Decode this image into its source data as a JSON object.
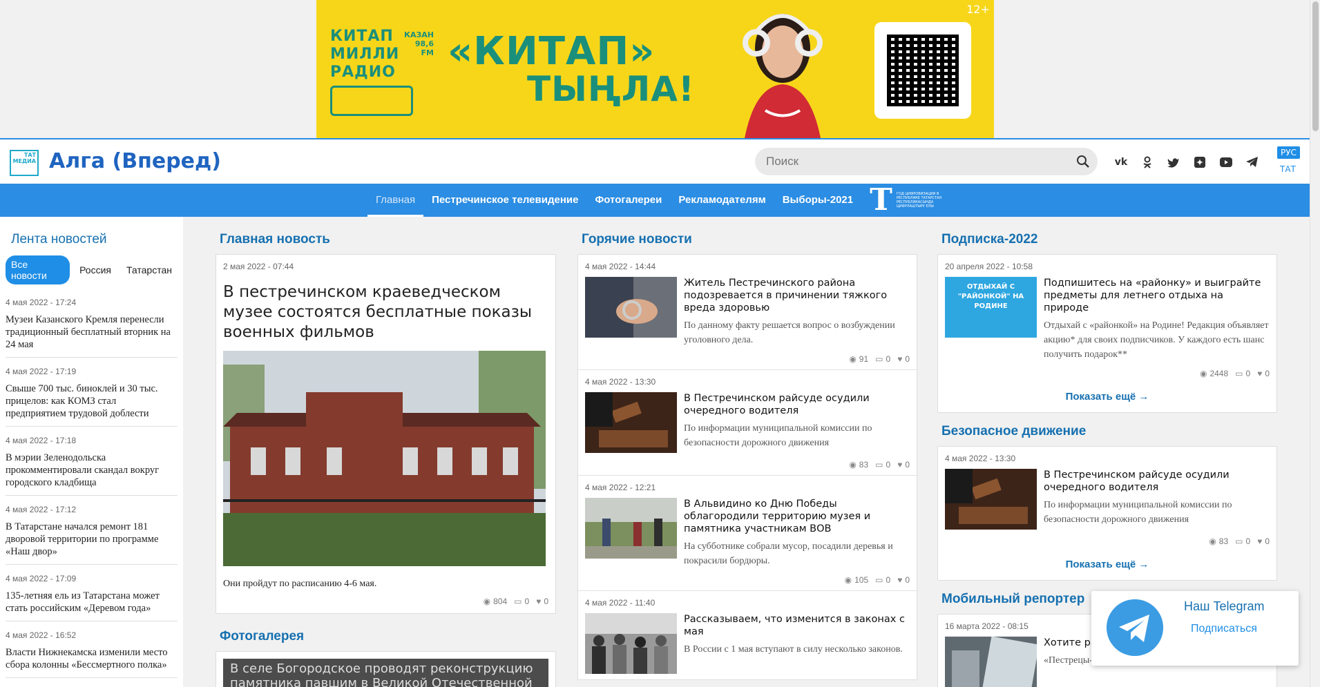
{
  "ad": {
    "logo_line1": "КИТАП",
    "logo_line2": "МИЛЛИ",
    "logo_line3": "РАДИО",
    "logo_city": "КАЗАН",
    "logo_freq": "98,6",
    "logo_fm": "FM",
    "title1": "«КИТАП»",
    "title2": "ТЫҢЛА!",
    "age": "12+",
    "accent": "#f7d61a",
    "text_color": "#1a8f7c"
  },
  "header": {
    "logo_text": "ТАТ МЕДИА",
    "title": "Алга (Вперед)",
    "search_placeholder": "Поиск",
    "socials": [
      "vk-icon",
      "odnoklassniki-icon",
      "twitter-icon",
      "yandex-zen-icon",
      "youtube-icon",
      "telegram-icon"
    ],
    "lang_active": "РУС",
    "lang_other": "ТАТ"
  },
  "nav": {
    "items": [
      "Главная",
      "Пестречинское телевидение",
      "Фотогалереи",
      "Рекламодателям",
      "Выборы-2021"
    ],
    "badge_letter": "Т",
    "badge_text": "ГОД ЦИФРОВИЗАЦИИ В РЕСПУБЛИКЕ ТАТАРСТАН РЕСПУБЛИКАСЫНДА ЦИФРЛАШТЫРУ ЕЛЫ",
    "color": "#2b8de3"
  },
  "feed": {
    "title": "Лента новостей",
    "tabs": [
      "Все новости",
      "Россия",
      "Татарстан"
    ],
    "items": [
      {
        "time": "4 мая 2022 - 17:24",
        "text": "Музеи Казанского Кремля перенесли традиционный бесплатный вторник на 24 мая"
      },
      {
        "time": "4 мая 2022 - 17:19",
        "text": "Свыше 700 тыс. биноклей и 30 тыс. прицелов: как КОМЗ стал предприятием трудовой доблести"
      },
      {
        "time": "4 мая 2022 - 17:18",
        "text": "В мэрии Зеленодольска прокомментировали скандал вокруг городского кладбища"
      },
      {
        "time": "4 мая 2022 - 17:12",
        "text": "В Татарстане начался ремонт 181 дворовой территории по программе «Наш двор»"
      },
      {
        "time": "4 мая 2022 - 17:09",
        "text": "135-летняя ель из Татарстана может стать российским «Деревом года»"
      },
      {
        "time": "4 мая 2022 - 16:52",
        "text": "Власти Нижнекамска изменили место сбора колонны «Бессмертного полка»"
      }
    ]
  },
  "main_news": {
    "section": "Главная новость",
    "date": "2 мая 2022 - 07:44",
    "headline": "В пестречинском краеведческом музее состоятся бесплатные показы военных фильмов",
    "caption": "Они пройдут по расписанию 4-6 мая.",
    "views": "804",
    "comments": "0",
    "likes": "0"
  },
  "photo_gallery": {
    "section": "Фотогалерея",
    "caption": "В селе Богородское проводят реконструкцию памятника павшим в Великой Отечественной войне на"
  },
  "hot_news": {
    "section": "Горячие новости",
    "items": [
      {
        "date": "4 мая 2022 - 14:44",
        "title": "Житель Пестречинского района подозревается в причинении тяжкого вреда здоровью",
        "lead": "По данному факту решается вопрос о возбуждении уголовного дела.",
        "views": "91",
        "comments": "0",
        "likes": "0"
      },
      {
        "date": "4 мая 2022 - 13:30",
        "title": "В Пестречинском райсуде осудили очередного водителя",
        "lead": "По информации муниципальной комиссии по безопасности дорожного движения",
        "views": "83",
        "comments": "0",
        "likes": "0"
      },
      {
        "date": "4 мая 2022 - 12:21",
        "title": "В Альвидино ко Дню Победы облагородили территорию музея и памятника участникам ВОВ",
        "lead": "На субботнике собрали мусор, посадили деревья и покрасили бордюры.",
        "views": "105",
        "comments": "0",
        "likes": "0"
      },
      {
        "date": "4 мая 2022 - 11:40",
        "title": "Рассказываем, что изменится в законах с мая",
        "lead": "В России с 1 мая вступают в силу несколько законов.",
        "views": "",
        "comments": "",
        "likes": ""
      }
    ]
  },
  "subscription": {
    "section": "Подписка-2022",
    "date": "20 апреля 2022 - 10:58",
    "title": "Подпишитесь на «районку» и выиграйте предметы для летнего отдыха на природе",
    "lead": "Отдыхай с «районкой» на Родине! Редакция объявляет акцию* для своих подписчиков. У каждого есть шанс получить подарок**",
    "thumb_text": "ОТДЫХАЙ С \"РАЙОНКОЙ\" НА РОДИНЕ",
    "views": "2448",
    "comments": "0",
    "likes": "0",
    "more": "Показать ещё"
  },
  "safe_traffic": {
    "section": "Безопасное движение",
    "date": "4 мая 2022 - 13:30",
    "title": "В Пестречинском райсуде осудили очередного водителя",
    "lead": "По информации муниципальной комиссии по безопасности дорожного движения",
    "views": "83",
    "comments": "0",
    "likes": "0",
    "more": "Показать ещё"
  },
  "mobile_reporter": {
    "section": "Мобильный репортер",
    "date": "16 марта 2022 - 08:15",
    "title": "Хотите ра... на свя...",
    "lead": "«Пестрецы-информ» запустило в соцсетях новую"
  },
  "telegram": {
    "title": "Наш Telegram",
    "subscribe": "Подписаться"
  }
}
